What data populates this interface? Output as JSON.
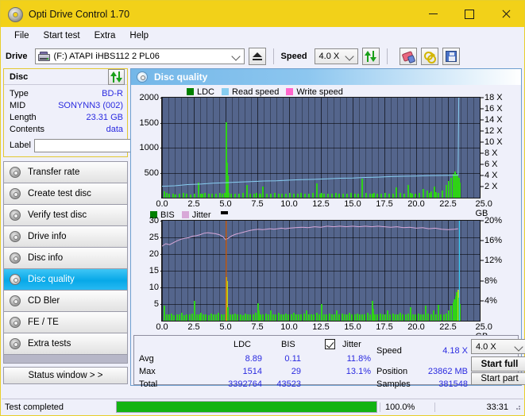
{
  "window": {
    "title": "Opti Drive Control 1.70",
    "icon": "disc-icon",
    "minimize": "─",
    "maximize": "□",
    "close": "✕"
  },
  "menu": {
    "items": [
      "File",
      "Start test",
      "Extra",
      "Help"
    ]
  },
  "toolbar": {
    "drive_label": "Drive",
    "drive_value": "(F:)  ATAPI iHBS112  2 PL06",
    "eject_title": "Eject",
    "speed_label": "Speed",
    "speed_value": "4.0 X",
    "refresh_icon": "refresh-icon",
    "erase_icon": "eraser-icon",
    "keys_icon": "keys-icon",
    "save_icon": "floppy-save-icon"
  },
  "disc_panel": {
    "header": "Disc",
    "refresh_icon": "refresh-icon",
    "rows": [
      {
        "key": "Type",
        "value": "BD-R"
      },
      {
        "key": "MID",
        "value": "SONYNN3 (002)"
      },
      {
        "key": "Length",
        "value": "23.31 GB"
      },
      {
        "key": "Contents",
        "value": "data"
      }
    ],
    "label_key": "Label",
    "label_value": "",
    "label_placeholder": "",
    "disc_button_icon": "cd-icon"
  },
  "sidebar": {
    "items": [
      {
        "label": "Transfer rate",
        "active": false
      },
      {
        "label": "Create test disc",
        "active": false
      },
      {
        "label": "Verify test disc",
        "active": false
      },
      {
        "label": "Drive info",
        "active": false
      },
      {
        "label": "Disc info",
        "active": false
      },
      {
        "label": "Disc quality",
        "active": true
      },
      {
        "label": "CD Bler",
        "active": false
      },
      {
        "label": "FE / TE",
        "active": false
      },
      {
        "label": "Extra tests",
        "active": false
      }
    ],
    "status_window_button": "Status window > >"
  },
  "pane": {
    "title": "Disc quality",
    "icon": "disc-quality-icon"
  },
  "chart_data": [
    {
      "type": "bar",
      "id": "top-chart",
      "title": "",
      "xlabel": "GB",
      "ylabel": "",
      "legend": [
        {
          "label": "LDC",
          "color": "#008000"
        },
        {
          "label": "Read speed",
          "color": "#87cdf0"
        },
        {
          "label": "Write speed",
          "color": "#ff66cc"
        }
      ],
      "legend_position": "top-left",
      "grid": true,
      "xlim": [
        0,
        25.0
      ],
      "xticks": [
        "0.0",
        "2.5",
        "5.0",
        "7.5",
        "10.0",
        "12.5",
        "15.0",
        "17.5",
        "20.0",
        "22.5",
        "25.0"
      ],
      "xunit": "GB",
      "ylim": [
        0,
        2000
      ],
      "yticks": [
        "2000",
        "1500",
        "1000",
        "500"
      ],
      "y2lim": [
        0,
        18
      ],
      "y2ticks": [
        "18 X",
        "16 X",
        "14 X",
        "12 X",
        "10 X",
        "8 X",
        "6 X",
        "4 X",
        "2 X"
      ],
      "series": [
        {
          "name": "LDC",
          "color": "#2fd216",
          "type": "bar",
          "x": [
            0.1,
            0.3,
            0.5,
            0.8,
            1.0,
            1.3,
            1.6,
            1.9,
            2.2,
            2.5,
            2.8,
            3.0,
            3.1,
            3.3,
            3.6,
            3.9,
            4.2,
            4.5,
            4.7,
            4.9,
            5.0,
            5.05,
            5.1,
            5.2,
            5.4,
            5.7,
            6.0,
            6.3,
            6.6,
            6.9,
            7.2,
            7.4,
            7.6,
            7.7,
            7.9,
            8.2,
            8.5,
            8.8,
            9.1,
            9.4,
            9.7,
            10.0,
            10.3,
            10.6,
            10.9,
            11.2,
            11.5,
            11.8,
            12.1,
            12.4,
            12.5,
            12.7,
            13.0,
            13.3,
            13.6,
            13.9,
            14.2,
            14.5,
            14.8,
            15.1,
            15.4,
            15.7,
            16.0,
            16.3,
            16.5,
            16.6,
            16.9,
            17.2,
            17.5,
            17.8,
            18.1,
            18.4,
            18.7,
            19.0,
            19.3,
            19.5,
            19.6,
            19.9,
            20.2,
            20.5,
            20.8,
            21.0,
            21.1,
            21.4,
            21.5,
            21.7,
            22.0,
            22.3,
            22.5,
            22.7,
            22.9,
            23.0,
            23.1,
            23.2,
            23.3,
            23.35
          ],
          "values": [
            120,
            95,
            80,
            85,
            70,
            75,
            90,
            85,
            70,
            80,
            300,
            85,
            75,
            90,
            80,
            75,
            85,
            95,
            80,
            90,
            1514,
            700,
            450,
            95,
            80,
            85,
            75,
            90,
            260,
            80,
            85,
            95,
            80,
            75,
            220,
            85,
            75,
            90,
            80,
            85,
            75,
            95,
            85,
            80,
            90,
            75,
            85,
            95,
            290,
            85,
            90,
            80,
            75,
            85,
            95,
            80,
            75,
            85,
            90,
            80,
            75,
            380,
            90,
            85,
            80,
            95,
            85,
            75,
            90,
            80,
            85,
            200,
            90,
            80,
            250,
            95,
            85,
            80,
            90,
            180,
            150,
            95,
            120,
            230,
            110,
            95,
            140,
            260,
            330,
            400,
            480,
            520,
            470,
            440,
            400,
            300
          ]
        },
        {
          "name": "Read speed",
          "color": "#87cdf0",
          "type": "line",
          "x": [
            0.0,
            1.0,
            2.0,
            3.0,
            4.0,
            5.0,
            6.0,
            7.0,
            8.0,
            9.0,
            10.0,
            11.0,
            12.0,
            13.0,
            14.0,
            15.0,
            16.0,
            17.0,
            18.0,
            19.0,
            20.0,
            21.0,
            22.0,
            23.0,
            23.3,
            23.35,
            23.4
          ],
          "values": [
            2.05,
            2.15,
            2.35,
            2.45,
            2.6,
            2.7,
            2.8,
            2.9,
            3.0,
            3.05,
            3.15,
            3.25,
            3.3,
            3.4,
            3.5,
            3.55,
            3.65,
            3.7,
            3.8,
            3.85,
            3.9,
            3.95,
            4.0,
            4.05,
            4.05,
            18.0,
            18.0
          ],
          "axis": "right"
        },
        {
          "name": "Write speed",
          "color": "#ff66cc",
          "type": "line",
          "x": [],
          "values": []
        }
      ]
    },
    {
      "type": "bar",
      "id": "bottom-chart",
      "title": "",
      "xlabel": "GB",
      "legend": [
        {
          "label": "BIS",
          "color": "#008000"
        },
        {
          "label": "Jitter",
          "color": "#d8a8d8"
        }
      ],
      "legend_position": "top-left",
      "grid": true,
      "xlim": [
        0,
        25.0
      ],
      "xticks": [
        "0.0",
        "2.5",
        "5.0",
        "7.5",
        "10.0",
        "12.5",
        "15.0",
        "17.5",
        "20.0",
        "22.5",
        "25.0"
      ],
      "xunit": "GB",
      "ylim": [
        0,
        30
      ],
      "yticks": [
        "30",
        "25",
        "20",
        "15",
        "10",
        "5"
      ],
      "y2lim": [
        0,
        20
      ],
      "y2ticks": [
        "20%",
        "16%",
        "12%",
        "8%",
        "4%"
      ],
      "series": [
        {
          "name": "BIS",
          "color": "#2fd216",
          "type": "bar",
          "x": [
            0.1,
            0.3,
            0.5,
            0.7,
            0.9,
            1.1,
            1.3,
            1.5,
            1.7,
            1.9,
            2.1,
            2.3,
            2.5,
            2.7,
            2.9,
            3.0,
            3.2,
            3.4,
            3.6,
            3.8,
            4.0,
            4.2,
            4.4,
            4.6,
            4.8,
            5.0,
            5.05,
            5.1,
            5.3,
            5.5,
            5.7,
            5.9,
            6.1,
            6.3,
            6.5,
            6.7,
            6.9,
            7.1,
            7.3,
            7.5,
            7.55,
            7.7,
            7.9,
            8.1,
            8.3,
            8.5,
            8.7,
            8.9,
            9.1,
            9.3,
            9.5,
            9.7,
            9.9,
            10.1,
            10.3,
            10.5,
            10.7,
            10.9,
            11.1,
            11.3,
            11.5,
            11.7,
            11.9,
            12.1,
            12.3,
            12.5,
            12.7,
            12.9,
            13.1,
            13.3,
            13.5,
            13.7,
            13.9,
            14.1,
            14.3,
            14.5,
            14.7,
            14.9,
            15.1,
            15.3,
            15.5,
            15.7,
            15.9,
            16.1,
            16.3,
            16.5,
            16.55,
            16.7,
            16.9,
            17.1,
            17.3,
            17.5,
            17.7,
            17.9,
            18.1,
            18.3,
            18.5,
            18.7,
            18.9,
            19.1,
            19.3,
            19.5,
            19.7,
            19.9,
            20.1,
            20.3,
            20.5,
            20.7,
            20.9,
            21.1,
            21.3,
            21.5,
            21.7,
            21.9,
            22.1,
            22.3,
            22.5,
            22.7,
            22.85,
            22.95,
            23.05,
            23.15,
            23.25,
            23.3,
            23.35
          ],
          "values": [
            4.5,
            2.0,
            1.8,
            2.2,
            1.6,
            2.0,
            1.8,
            2.4,
            1.7,
            2.0,
            1.9,
            2.2,
            6.0,
            2.0,
            1.8,
            2.4,
            1.9,
            2.0,
            1.7,
            2.2,
            1.8,
            2.0,
            2.3,
            1.9,
            2.0,
            13.2,
            12.0,
            4.0,
            2.0,
            1.8,
            2.2,
            1.9,
            2.0,
            1.7,
            2.2,
            1.9,
            2.0,
            1.8,
            2.3,
            5.2,
            3.0,
            2.0,
            1.8,
            2.2,
            1.9,
            3.0,
            2.0,
            1.8,
            2.4,
            1.9,
            2.0,
            2.2,
            1.8,
            2.0,
            2.3,
            1.9,
            2.0,
            1.8,
            2.2,
            3.2,
            1.9,
            2.0,
            1.8,
            2.4,
            2.0,
            5.0,
            2.0,
            1.8,
            2.2,
            1.9,
            2.0,
            3.0,
            1.8,
            2.2,
            1.9,
            2.0,
            2.4,
            1.8,
            2.0,
            2.2,
            1.9,
            2.0,
            1.8,
            2.3,
            2.0,
            6.0,
            3.5,
            2.0,
            1.8,
            2.2,
            1.9,
            2.0,
            3.0,
            1.8,
            2.2,
            2.0,
            1.9,
            2.4,
            1.8,
            2.0,
            2.2,
            4.0,
            1.9,
            2.0,
            2.2,
            1.8,
            2.0,
            4.5,
            2.2,
            1.9,
            3.0,
            2.0,
            4.8,
            1.9,
            2.0,
            2.2,
            3.0,
            4.5,
            5.5,
            6.5,
            7.5,
            8.6,
            9.2,
            7.0,
            5.0
          ]
        },
        {
          "name": "Jitter",
          "color": "#d8a8d8",
          "type": "line",
          "x": [
            0.0,
            0.3,
            0.6,
            0.9,
            1.2,
            1.5,
            1.8,
            2.1,
            2.4,
            2.7,
            3.0,
            3.3,
            3.6,
            3.9,
            4.2,
            4.5,
            4.8,
            5.0,
            5.2,
            5.5,
            5.8,
            6.1,
            6.4,
            6.7,
            7.0,
            7.3,
            7.6,
            7.9,
            8.2,
            8.5,
            8.8,
            9.1,
            9.4,
            9.7,
            10.0,
            10.5,
            11.0,
            11.5,
            12.0,
            12.5,
            13.0,
            13.5,
            14.0,
            14.5,
            15.0,
            15.5,
            16.0,
            16.5,
            17.0,
            17.5,
            18.0,
            18.5,
            19.0,
            19.5,
            20.0,
            20.5,
            21.0,
            21.5,
            22.0,
            22.5,
            23.0,
            23.3
          ],
          "values": [
            14.9,
            15.4,
            15.2,
            15.6,
            16.0,
            16.3,
            16.5,
            16.6,
            16.9,
            17.0,
            17.2,
            17.5,
            17.6,
            17.5,
            17.4,
            17.2,
            16.8,
            16.2,
            16.5,
            17.0,
            17.3,
            17.5,
            17.7,
            17.9,
            18.1,
            18.2,
            18.3,
            18.2,
            18.3,
            18.4,
            18.3,
            18.4,
            18.5,
            18.4,
            18.5,
            18.6,
            18.7,
            18.6,
            18.8,
            18.7,
            18.9,
            18.8,
            18.9,
            18.8,
            18.9,
            18.8,
            18.9,
            18.8,
            18.9,
            18.8,
            18.7,
            18.8,
            18.6,
            18.7,
            18.5,
            18.6,
            18.4,
            18.5,
            18.3,
            18.2,
            18.3,
            18.4
          ],
          "axis": "right"
        },
        {
          "name": "position-marker",
          "color": "#e06000",
          "type": "vline",
          "x": [
            5.05
          ]
        },
        {
          "name": "end-marker",
          "color": "#39c8f0",
          "type": "vline",
          "x": [
            23.4
          ]
        }
      ]
    }
  ],
  "stats": {
    "col_headers": {
      "ldc": "LDC",
      "bis": "BIS",
      "jitter": "Jitter"
    },
    "jitter_checked": true,
    "rows": [
      {
        "label": "Avg",
        "ldc": "8.89",
        "bis": "0.11",
        "jitter": "11.8%"
      },
      {
        "label": "Max",
        "ldc": "1514",
        "bis": "29",
        "jitter": "13.1%"
      },
      {
        "label": "Total",
        "ldc": "3392764",
        "bis": "43523",
        "jitter": ""
      }
    ],
    "speed_label": "Speed",
    "speed_value": "4.18 X",
    "position_label": "Position",
    "position_value": "23862 MB",
    "samples_label": "Samples",
    "samples_value": "381548",
    "speed_select": "4.0 X",
    "start_full": "Start full",
    "start_part": "Start part"
  },
  "statusbar": {
    "text": "Test completed",
    "progress_percent": 100.0,
    "progress_label": "100.0%",
    "time": "33:31"
  }
}
